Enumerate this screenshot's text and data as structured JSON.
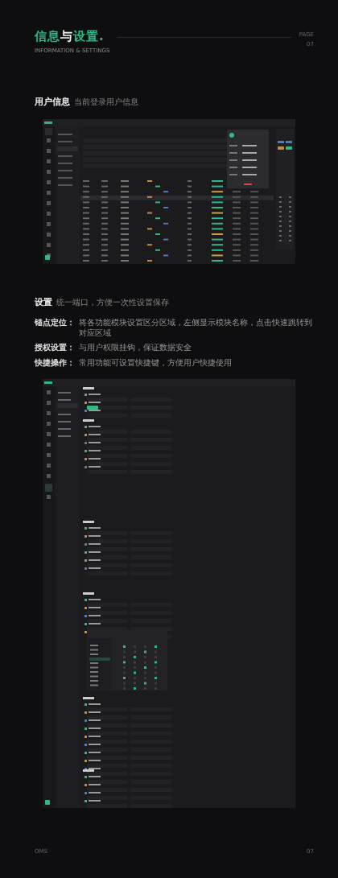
{
  "header": {
    "title_parts": [
      {
        "text": "信息",
        "accent": true
      },
      {
        "text": "与",
        "accent": false
      },
      {
        "text": "设置.",
        "accent": true
      }
    ],
    "subtitle": "INFORMATION & SETTINGS",
    "page_label": "PAGE",
    "page_number": "07"
  },
  "user_info": {
    "title": "用户信息",
    "caption": "当前登录用户信息"
  },
  "settings": {
    "title": "设置",
    "caption": "统一端口，方便一次性设置保存",
    "notes": [
      {
        "label": "锚点定位：",
        "text": "将各功能模块设置区分区域，左侧显示模块名称，点击快速跳转到对应区域"
      },
      {
        "label": "授权设置：",
        "text": "与用户权限挂钩，保证数据安全"
      },
      {
        "label": "快捷操作：",
        "text": "常用功能可设置快捷键，方便用户快捷使用"
      }
    ]
  },
  "footer": {
    "brand": "OMS",
    "page": "07"
  }
}
